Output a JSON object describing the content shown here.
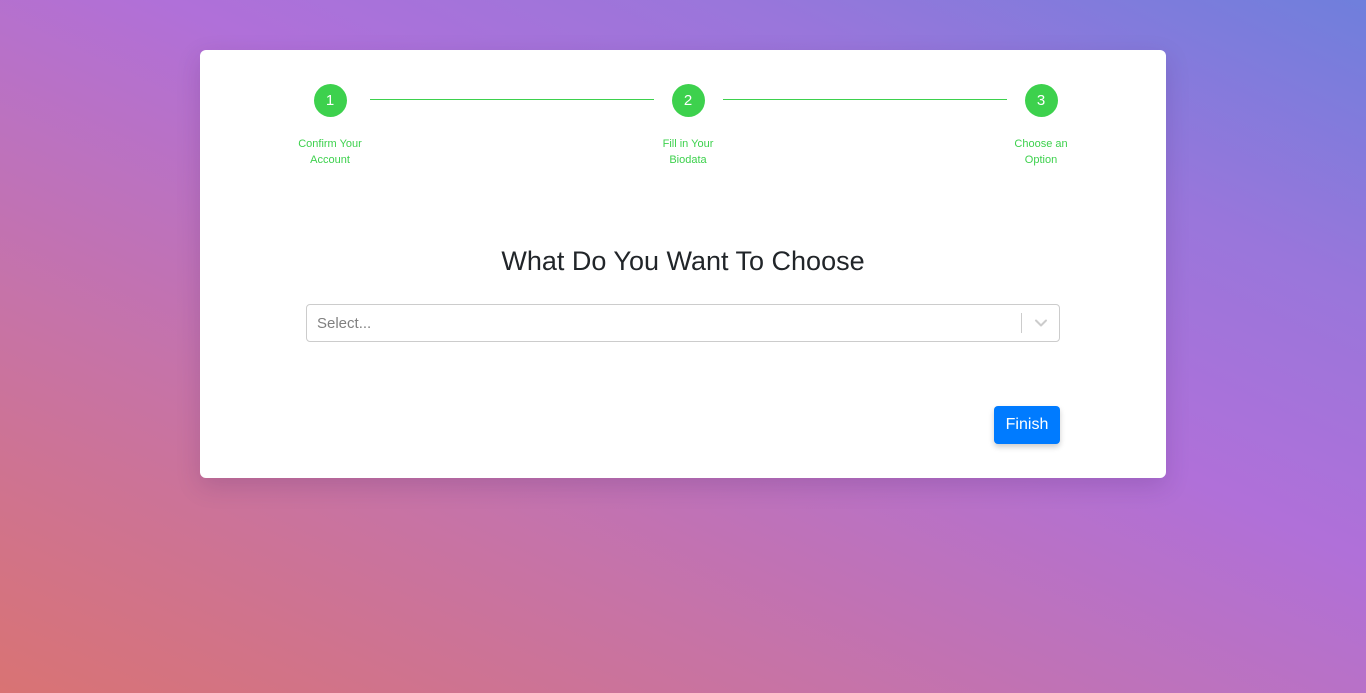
{
  "stepper": {
    "steps": [
      {
        "number": "1",
        "label": "Confirm Your Account"
      },
      {
        "number": "2",
        "label": "Fill in Your Biodata"
      },
      {
        "number": "3",
        "label": "Choose an Option"
      }
    ],
    "active_color": "#3dd14d"
  },
  "form": {
    "title": "What Do You Want To Choose",
    "select_placeholder": "Select...",
    "select_icon": "chevron-down-icon"
  },
  "actions": {
    "finish_label": "Finish",
    "accent_color": "#007bff"
  }
}
